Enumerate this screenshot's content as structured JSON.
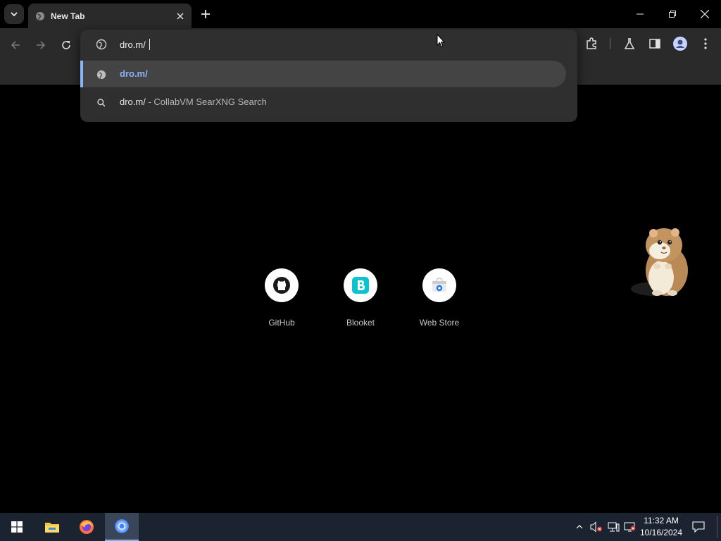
{
  "tabs": [
    {
      "title": "New Tab"
    }
  ],
  "omnibox": {
    "value": "dro.m/",
    "suggestions": [
      {
        "text": "dro.m/",
        "type": "url",
        "selected": true
      },
      {
        "text": "dro.m/",
        "description": "- CollabVM SearXNG Search",
        "type": "search"
      }
    ]
  },
  "shortcuts": [
    {
      "label": "GitHub",
      "icon": "github-icon"
    },
    {
      "label": "Blooket",
      "icon": "blooket-icon"
    },
    {
      "label": "Web Store",
      "icon": "web-store-icon"
    }
  ],
  "taskbar": {
    "clock_time": "11:32 AM",
    "clock_date": "10/16/2024",
    "apps": [
      "start-icon",
      "file-explorer-icon",
      "firefox-icon",
      "chrome-icon"
    ]
  },
  "colors": {
    "accent": "#8ab4f8",
    "toolbar": "#2a2a2a",
    "taskbar": "#1b2330"
  }
}
